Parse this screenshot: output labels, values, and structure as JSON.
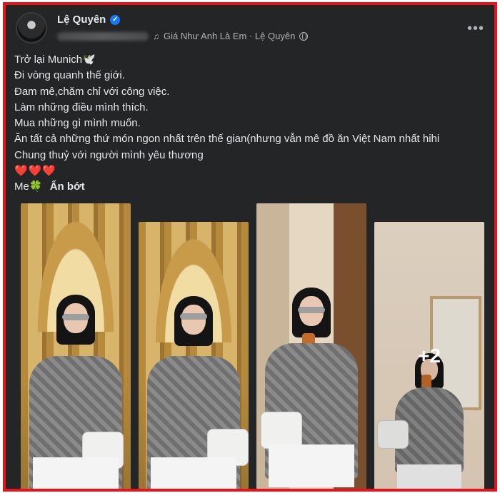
{
  "post": {
    "author_name": "Lệ Quyên",
    "verified_symbol": "✓",
    "music_symbol": "♫",
    "meta_text": "Giá Như Anh Là Em · Lệ Quyên",
    "more_symbol": "•••",
    "lines": [
      "Trở lại Munich🕊️",
      "Đi vòng quanh thế giới.",
      "Đam mê,chăm chỉ với công việc.",
      "Làm những điều mình thích.",
      "Mua những gì mình muốn.",
      "Ăn tất cả những thứ món ngon nhất trên thế gian(nhưng vẫn mê đồ ăn Việt Nam nhất hihi",
      "Chung thuỷ với người mình yêu thương"
    ],
    "hearts": "❤️❤️❤️",
    "signoff": "Me🍀",
    "see_less_label": "Ẩn bớt"
  },
  "photos": {
    "extra_count": "+2"
  },
  "colors": {
    "frame_border": "#e8141c",
    "background": "#242526",
    "text_primary": "#e4e6eb",
    "text_secondary": "#b0b3b8",
    "verified_blue": "#1877f2"
  }
}
